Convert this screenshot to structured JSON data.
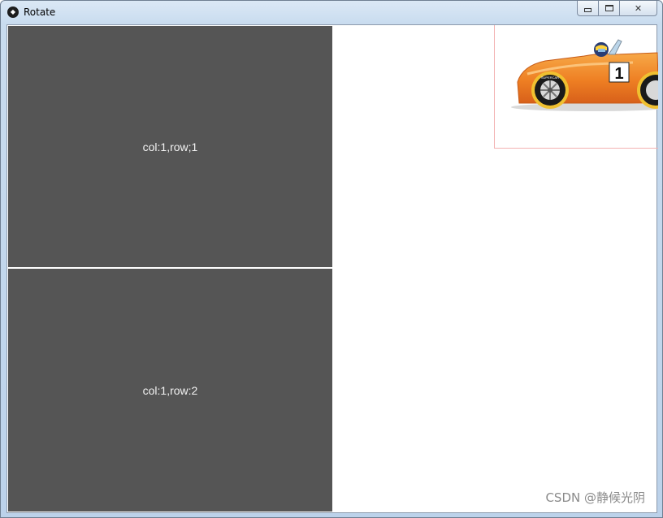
{
  "window": {
    "title": "Rotate",
    "app_icon": "kivy-logo-icon"
  },
  "caption_buttons": {
    "minimize_icon": "minimize-icon",
    "maximize_icon": "maximize-icon",
    "close_glyph": "✕"
  },
  "grid": {
    "cells": [
      {
        "label": "col:1,row;1"
      },
      {
        "label": "col:1,row:2"
      }
    ]
  },
  "image": {
    "subject": "race-car-icon",
    "number": "1",
    "tire_text": "SUPERCAR"
  },
  "watermark": "CSDN @静候光阴",
  "colors": {
    "cell_background": "#555555",
    "car_body": "#f08c2a",
    "image_border": "#f3b2b2"
  }
}
